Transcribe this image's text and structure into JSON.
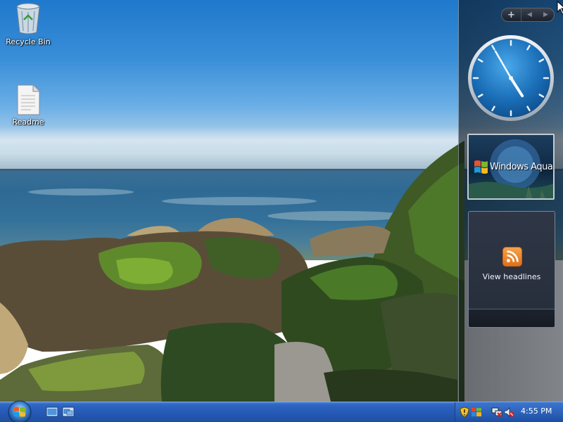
{
  "desktop": {
    "icons": [
      {
        "label": "Recycle Bin",
        "icon": "recycle-bin-icon"
      },
      {
        "label": "Readme",
        "icon": "text-document-icon"
      }
    ]
  },
  "sidebar": {
    "controls": {
      "add": "+",
      "prev": "◀",
      "next": "▶"
    },
    "clock": {
      "hour": 4,
      "minute": 55
    },
    "slideshow": {
      "title": "Windows Aqua"
    },
    "feed": {
      "label": "View headlines",
      "icon": "rss-feed-icon"
    }
  },
  "taskbar": {
    "start": "start-orb-icon",
    "quick_launch": [
      "show-desktop-icon",
      "switch-windows-icon"
    ],
    "tray": [
      "security-shield-icon",
      "network-icon",
      "network-disconnected-icon",
      "volume-muted-icon"
    ],
    "clock": "4:55 PM"
  },
  "colors": {
    "taskbar": "#2459b5",
    "sidebar": "#1a2230",
    "feed_icon": "#f08a2a"
  }
}
